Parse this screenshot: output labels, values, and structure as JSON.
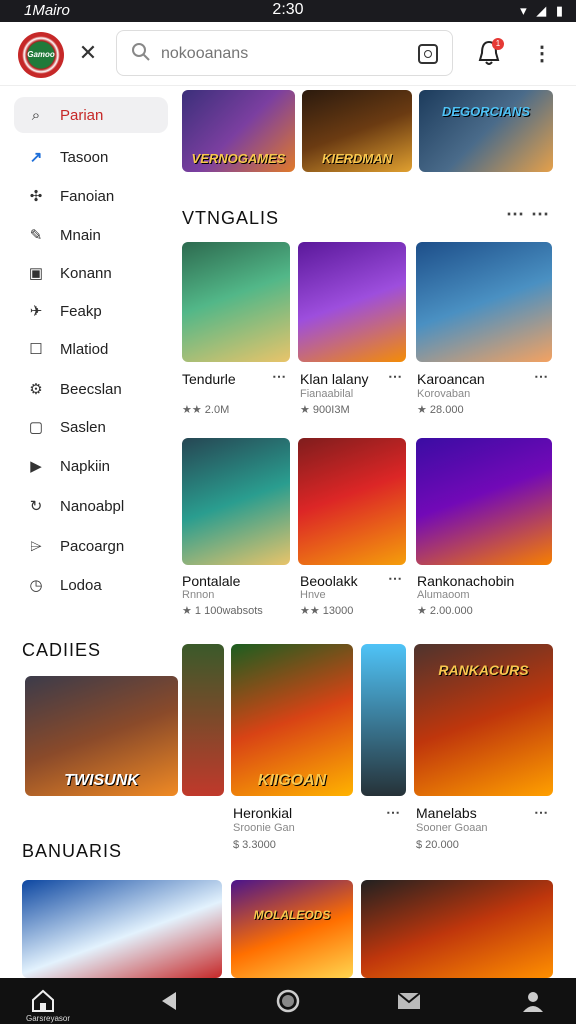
{
  "status": {
    "left": "1Mairo",
    "time": "2:30",
    "icons": "▾ ◢ ▮"
  },
  "header": {
    "logo_text": "Gamoo",
    "search_placeholder": "nokooanans",
    "notification_count": "1"
  },
  "sidebar": {
    "items": [
      {
        "label": "Parian",
        "icon": "search-icon"
      },
      {
        "label": "Tasoon",
        "icon": "trending-icon"
      },
      {
        "label": "Fanoian",
        "icon": "puzzle-icon"
      },
      {
        "label": "Mnain",
        "icon": "edit-icon"
      },
      {
        "label": "Konann",
        "icon": "card-icon"
      },
      {
        "label": "Feakp",
        "icon": "plane-icon"
      },
      {
        "label": "Mlatiod",
        "icon": "square-icon"
      },
      {
        "label": "Beecslan",
        "icon": "gear-icon"
      },
      {
        "label": "Saslen",
        "icon": "box-icon"
      },
      {
        "label": "Napkiin",
        "icon": "video-icon"
      },
      {
        "label": "Nanoabpl",
        "icon": "refresh-icon"
      },
      {
        "label": "Pacoargn",
        "icon": "tag-icon"
      },
      {
        "label": "Lodoa",
        "icon": "clock-icon"
      }
    ]
  },
  "top_banners": [
    {
      "text": "VERNOGAMES",
      "colors": [
        "#3b2f7a",
        "#e07a2a"
      ]
    },
    {
      "text": "KIERDMAN",
      "colors": [
        "#2b1a0e",
        "#e0a030"
      ]
    },
    {
      "text": "DEGORCIANS",
      "colors": [
        "#1c3b5c",
        "#e5a04a"
      ]
    }
  ],
  "section1": {
    "title": "VTNGALIS",
    "cards": [
      {
        "title": "Tendurle",
        "sub": "",
        "rating": "★★ 2.0M",
        "colors": [
          "#2d6a4f",
          "#e9c46a"
        ]
      },
      {
        "title": "Klan lalany",
        "sub": "Fianaabilal",
        "rating": "★ 900I3M",
        "colors": [
          "#5a189a",
          "#f48c06"
        ]
      },
      {
        "title": "Karoancan",
        "sub": "Korovaban",
        "rating": "★ 28.000",
        "colors": [
          "#1d4e89",
          "#f4a261"
        ]
      },
      {
        "title": "Pontalale",
        "sub": "Rnnon",
        "rating": "★ 1 100wabsots",
        "colors": [
          "#264653",
          "#e9c46a"
        ]
      },
      {
        "title": "Beoolakk",
        "sub": "Hnve",
        "rating": "★★ 13000",
        "colors": [
          "#7f1d1d",
          "#f59e0b"
        ]
      },
      {
        "title": "Rankonachobin",
        "sub": "Alumaoom",
        "rating": "★ 2.00.000",
        "colors": [
          "#3a0ca3",
          "#f77f00"
        ]
      }
    ]
  },
  "section2": {
    "title": "CADIIES",
    "feature_text": "TWISUNK",
    "cards": [
      {
        "title": "Heronkial",
        "sub": "Sroonie Gan",
        "rating": "$ 3.3000",
        "text": "KIIGOAN"
      },
      {
        "title": "Manelabs",
        "sub": "Sooner Goaan",
        "rating": "$ 20.000",
        "text": "RANKACURS"
      }
    ]
  },
  "section3": {
    "title": "BANUARIS",
    "banner_text": "MOLALEODS"
  },
  "nav": {
    "home_label": "Garsreyasor"
  }
}
